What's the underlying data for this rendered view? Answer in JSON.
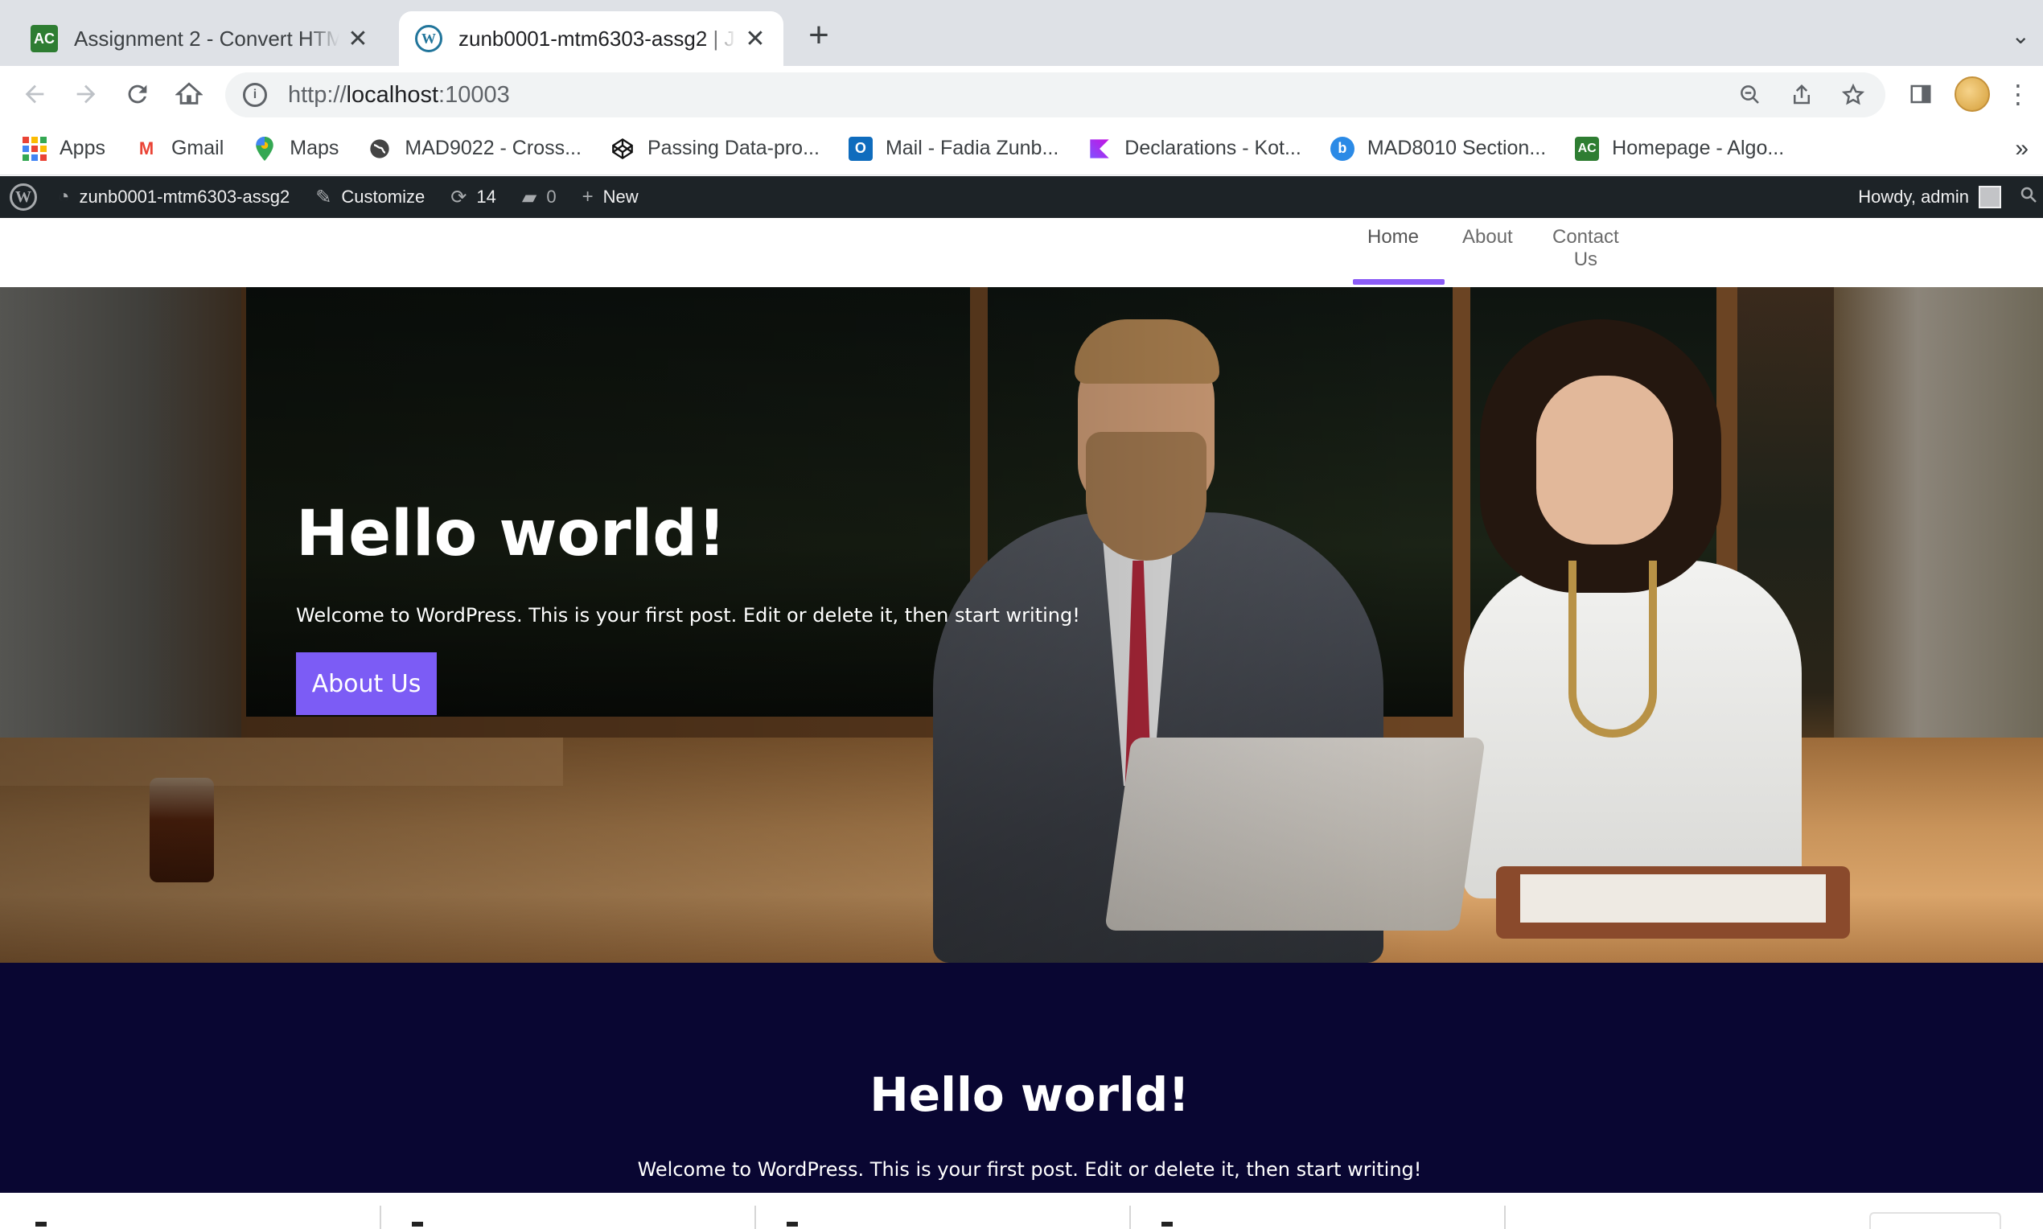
{
  "browser": {
    "tabs": [
      {
        "title": "Assignment 2 - Convert HTML",
        "favicon": "AC",
        "active": false
      },
      {
        "title": "zunb0001-mtm6303-assg2 | J",
        "favicon": "W",
        "active": true
      }
    ],
    "url_scheme": "http://",
    "url_host": "localhost",
    "url_port": ":10003",
    "bookmarks": [
      {
        "label": "Apps",
        "icon": "apps-grid-icon"
      },
      {
        "label": "Gmail",
        "icon": "gmail-icon"
      },
      {
        "label": "Maps",
        "icon": "maps-pin-icon"
      },
      {
        "label": "MAD9022 - Cross...",
        "icon": "globe-icon"
      },
      {
        "label": "Passing Data-pro...",
        "icon": "codepen-icon"
      },
      {
        "label": "Mail - Fadia Zunb...",
        "icon": "outlook-icon"
      },
      {
        "label": "Declarations - Kot...",
        "icon": "kotlin-icon"
      },
      {
        "label": "MAD8010 Section...",
        "icon": "brightspace-icon"
      },
      {
        "label": "Homepage - Algo...",
        "icon": "ac-icon"
      }
    ],
    "bookmarks_more": "»"
  },
  "admin_bar": {
    "site_name": "zunb0001-mtm6303-assg2",
    "customize": "Customize",
    "updates_count": "14",
    "comments_count": "0",
    "new_label": "New",
    "howdy": "Howdy, admin"
  },
  "site": {
    "nav": [
      {
        "label": "Home",
        "active": true
      },
      {
        "label": "About",
        "active": false
      },
      {
        "label": "Contact Us",
        "active": false
      }
    ],
    "hero": {
      "title": "Hello world!",
      "text": "Welcome to WordPress. This is your first post. Edit or delete it, then start writing!",
      "button": "About Us"
    },
    "section": {
      "title": "Hello world!",
      "text": "Welcome to WordPress. This is your first post. Edit or delete it, then start writing!"
    }
  },
  "colors": {
    "accent": "#7c5cf5",
    "dark_section": "#090632",
    "admin_bar": "#1d2327"
  }
}
